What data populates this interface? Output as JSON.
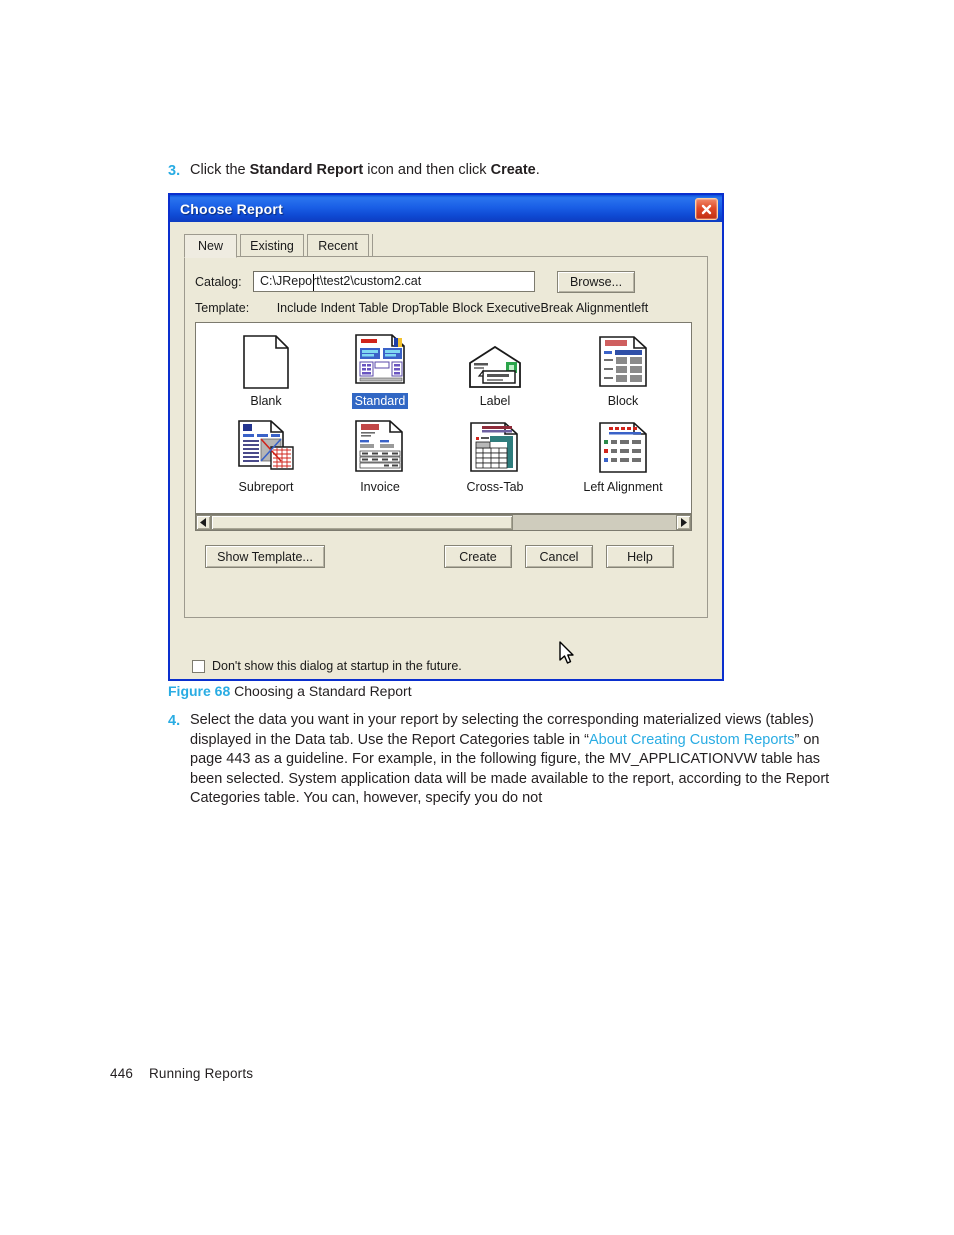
{
  "document": {
    "step3": {
      "number": "3.",
      "text_1": "Click the ",
      "bold_1": "Standard Report",
      "text_2": " icon and then click ",
      "bold_2": "Create",
      "text_3": "."
    },
    "figure_caption": {
      "label": "Figure 68",
      "text": "Choosing a Standard Report"
    },
    "step4": {
      "number": "4.",
      "text_1": "Select the data you want in your report by selecting the corresponding materialized views (tables) displayed in the Data tab. Use the Report Categories table in “",
      "link": "About Creating Custom Reports",
      "text_2": "” on page 443 as a guideline. For example, in the following figure, the MV_APPLICATIONVW table has been selected. System application data will be made available to the report, according to the Report Categories table. You can, however, specify you do not"
    },
    "footer": {
      "page_number": "446",
      "section": "Running Reports"
    },
    "colors": {
      "accent": "#29ace3",
      "body_text": "#231f20"
    }
  },
  "dialog": {
    "title": "Choose Report",
    "close_icon": "close-icon",
    "tabs": [
      {
        "label": "New",
        "selected": true
      },
      {
        "label": "Existing",
        "selected": false
      },
      {
        "label": "Recent",
        "selected": false
      }
    ],
    "catalog": {
      "label": "Catalog:",
      "value": "C:\\JReport\\test2\\custom2.cat",
      "placeholder": "",
      "browse_label": "Browse..."
    },
    "template": {
      "label": "Template:",
      "value": "Include Indent Table DropTable Block ExecutiveBreak Alignmentleft"
    },
    "templates": [
      {
        "name": "Blank",
        "icon": "blank-page-icon",
        "selected": false
      },
      {
        "name": "Standard",
        "icon": "standard-report-icon",
        "selected": true
      },
      {
        "name": "Label",
        "icon": "envelope-label-icon",
        "selected": false
      },
      {
        "name": "Block",
        "icon": "block-report-icon",
        "selected": false
      },
      {
        "name": "Subreport",
        "icon": "subreport-icon",
        "selected": false
      },
      {
        "name": "Invoice",
        "icon": "invoice-icon",
        "selected": false
      },
      {
        "name": "Cross-Tab",
        "icon": "cross-tab-icon",
        "selected": false
      },
      {
        "name": "Left Alignment",
        "icon": "left-alignment-icon",
        "selected": false
      }
    ],
    "scrollbar": {
      "left_arrow": "chevron-left-icon",
      "right_arrow": "chevron-right-icon",
      "thumb_fraction": "0.65"
    },
    "buttons": {
      "show_template": "Show Template...",
      "create": "Create",
      "cancel": "Cancel",
      "help": "Help"
    },
    "checkbox": {
      "label": "Don't show this dialog at startup in the future.",
      "checked": false
    },
    "colors": {
      "titlebar_blue": "#1a5fe6",
      "border_blue": "#0a2fce",
      "face": "#ece9d8",
      "selection_blue": "#3167c4",
      "close_red": "#c12f12"
    }
  }
}
